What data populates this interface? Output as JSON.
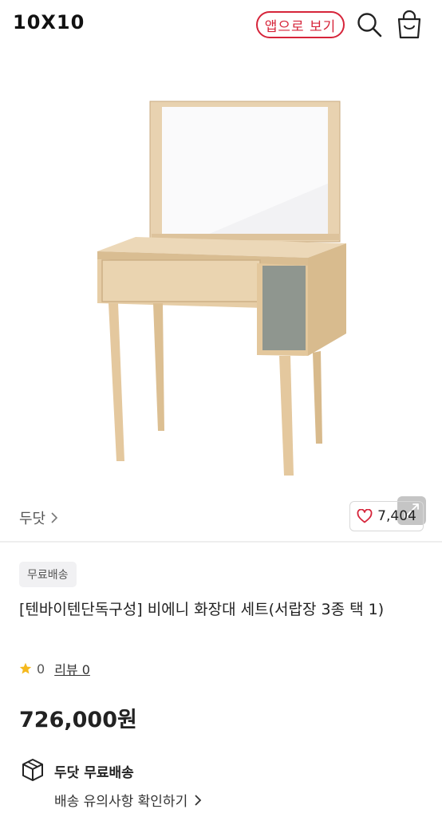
{
  "header": {
    "logo": "10X10",
    "app_button_label": "앱으로 보기"
  },
  "product": {
    "image_alt": "비에니 화장대 세트",
    "brand": "두닷",
    "like_count": "7,404",
    "badge": "무료배송",
    "title": "[텐바이텐단독구성] 비에니 화장대 세트(서랍장 3종 택 1)",
    "rating": "0",
    "review_label": "리뷰 0",
    "price": "726,000원"
  },
  "delivery": {
    "title": "두닷 무료배송",
    "note": "배송 유의사항 확인하기"
  },
  "colors": {
    "accent": "#d6243a",
    "star": "#f5b91e",
    "heart": "#d6243a"
  }
}
